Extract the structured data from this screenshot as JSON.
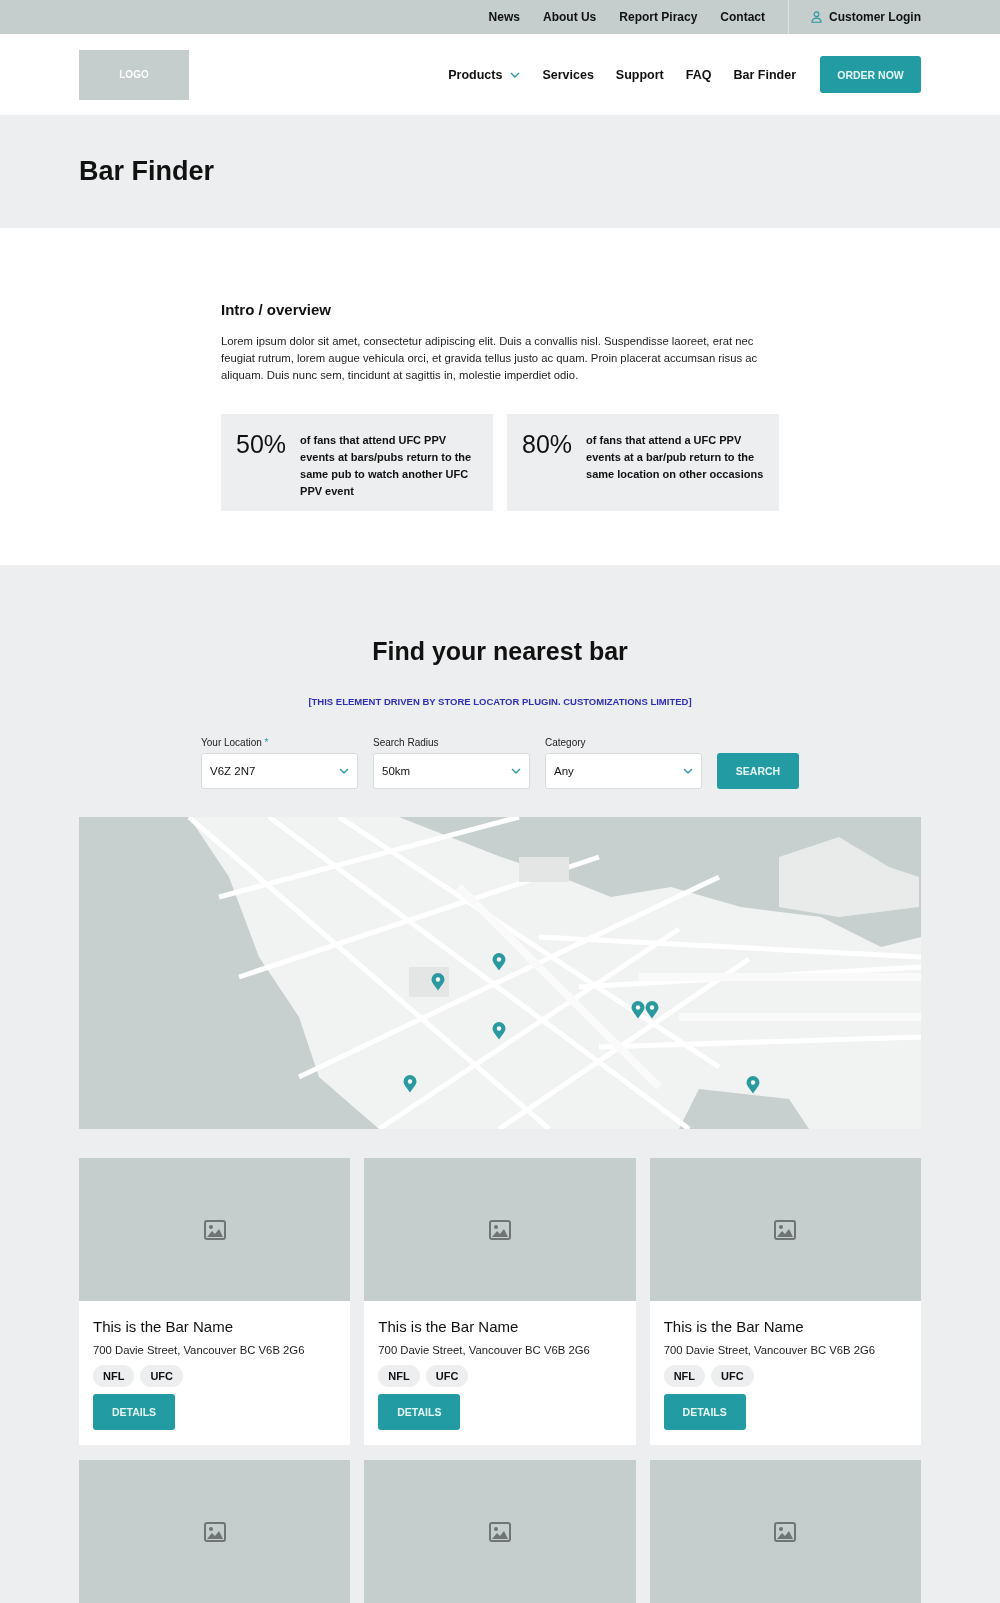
{
  "top_bar": {
    "links": [
      "News",
      "About Us",
      "Report Piracy",
      "Contact"
    ],
    "login": "Customer Login"
  },
  "header": {
    "logo": "LOGO",
    "nav": [
      {
        "label": "Products",
        "dropdown": true
      },
      {
        "label": "Services",
        "dropdown": false
      },
      {
        "label": "Support",
        "dropdown": false
      },
      {
        "label": "FAQ",
        "dropdown": false
      },
      {
        "label": "Bar Finder",
        "dropdown": false
      }
    ],
    "cta": "ORDER NOW"
  },
  "page_title": "Bar Finder",
  "intro": {
    "heading": "Intro / overview",
    "text": "Lorem ipsum dolor sit amet, consectetur adipiscing elit. Duis a  convallis nisl. Suspendisse laoreet, erat nec feugiat rutrum, lorem  augue vehicula orci, et gravida tellus justo ac quam. Proin placerat  accumsan risus ac aliquam. Duis nunc sem, tincidunt at sagittis in,  molestie imperdiet odio.",
    "stats": [
      {
        "value": "50%",
        "text": "of fans that attend UFC PPV events at bars/pubs return to the same pub to watch another UFC PPV event"
      },
      {
        "value": "80%",
        "text": "of fans that attend a UFC PPV events at a bar/pub return to the same location on other occasions"
      }
    ]
  },
  "finder": {
    "heading": "Find your nearest bar",
    "notice": "[THIS ELEMENT DRIVEN BY STORE LOCATOR PLUGIN. CUSTOMIZATIONS LIMITED]",
    "fields": [
      {
        "label": "Your Location",
        "required_mark": "*",
        "value": "V6Z 2N7"
      },
      {
        "label": "Search Radius",
        "value": "50km"
      },
      {
        "label": "Category",
        "value": "Any"
      }
    ],
    "search_button": "SEARCH",
    "cards": [
      {
        "kind": "full",
        "name": "This is the Bar Name",
        "address": "700 Davie Street, Vancouver BC V6B 2G6",
        "tags": [
          "NFL",
          "UFC"
        ],
        "button": "DETAILS"
      },
      {
        "kind": "full",
        "name": "This is the Bar Name",
        "address": "700 Davie Street, Vancouver BC V6B 2G6",
        "tags": [
          "NFL",
          "UFC"
        ],
        "button": "DETAILS"
      },
      {
        "kind": "full",
        "name": "This is the Bar Name",
        "address": "700 Davie Street, Vancouver BC V6B 2G6",
        "tags": [
          "NFL",
          "UFC"
        ],
        "button": "DETAILS"
      },
      {
        "kind": "cut"
      },
      {
        "kind": "cut"
      },
      {
        "kind": "cut"
      }
    ]
  }
}
